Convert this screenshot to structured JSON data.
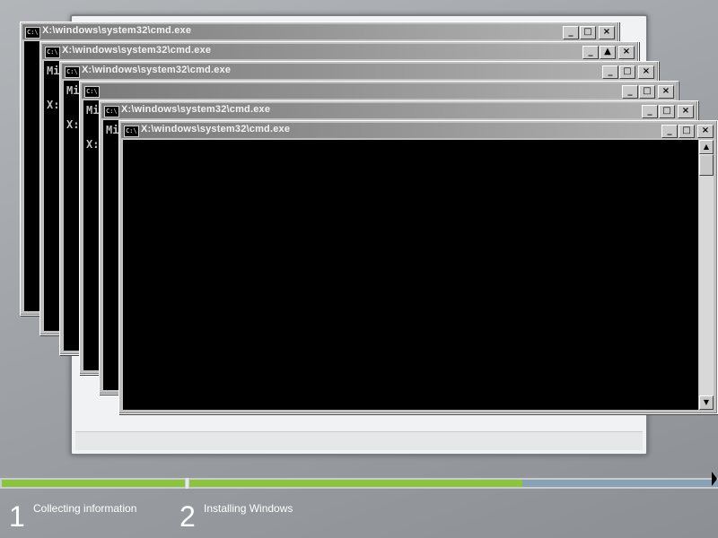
{
  "windows": [
    {
      "title": "X:\\windows\\system32\\cmd.exe",
      "text": ""
    },
    {
      "title": "X:\\windows\\system32\\cmd.exe",
      "text": "Mi\n\nX:"
    },
    {
      "title": "X:\\windows\\system32\\cmd.exe",
      "text": "Mi\n\nX:"
    },
    {
      "title": "",
      "text": "Mi\n\nX:"
    },
    {
      "title": "X:\\windows\\system32\\cmd.exe",
      "text": "Mi"
    },
    {
      "title": "X:\\windows\\system32\\cmd.exe",
      "text": ""
    }
  ],
  "icons": {
    "console": "console-icon",
    "minimize": "minimize-icon",
    "maximize": "maximize-icon",
    "close": "close-icon",
    "scroll_up": "scroll-up-icon",
    "scroll_down": "scroll-down-icon"
  },
  "progress": {
    "steps": [
      {
        "number": "1",
        "label": "Collecting information",
        "progress": 1.0
      },
      {
        "number": "2",
        "label": "Installing Windows",
        "progress": 0.63
      }
    ],
    "colors": {
      "done": "#8cc43f",
      "pending": "#8aa0b3"
    }
  }
}
